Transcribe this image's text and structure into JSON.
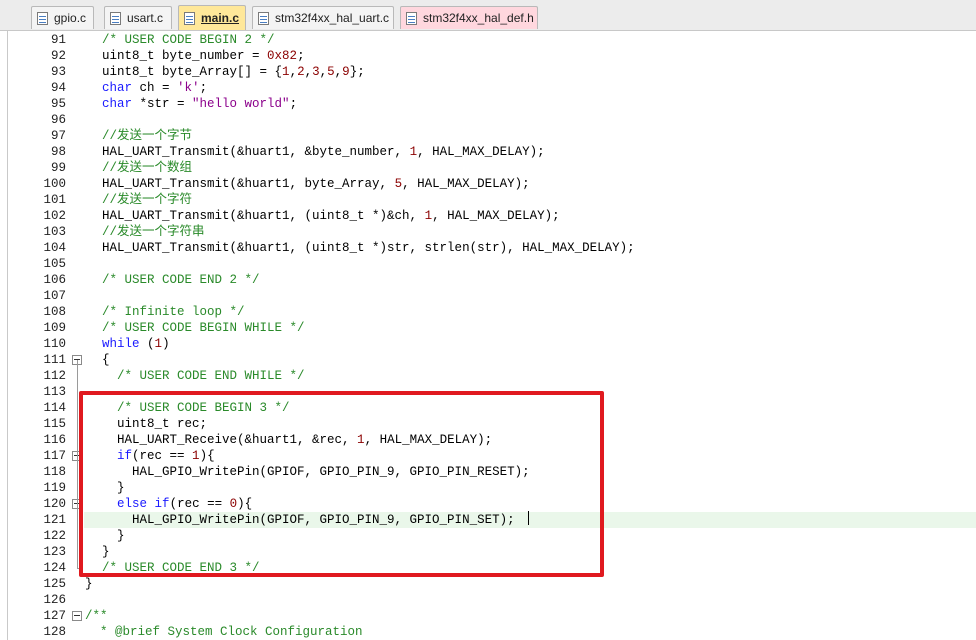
{
  "tabs": [
    {
      "label": "gpio.c",
      "active": false,
      "tint": "normal"
    },
    {
      "label": "usart.c",
      "active": false,
      "tint": "normal"
    },
    {
      "label": "main.c",
      "active": true,
      "tint": "active"
    },
    {
      "label": "stm32f4xx_hal_uart.c",
      "active": false,
      "tint": "normal"
    },
    {
      "label": "stm32f4xx_hal_def.h",
      "active": false,
      "tint": "pink"
    }
  ],
  "editor": {
    "current_line": 121,
    "highlight_color": "#e0191f",
    "lines": [
      {
        "n": "91",
        "text": "/* USER CODE BEGIN 2 */"
      },
      {
        "n": "92",
        "text": "uint8_t byte_number = 0x82;"
      },
      {
        "n": "93",
        "text": "uint8_t byte_Array[] = {1,2,3,5,9};"
      },
      {
        "n": "94",
        "text": "char ch = 'k';"
      },
      {
        "n": "95",
        "text": "char *str = \"hello world\";"
      },
      {
        "n": "96",
        "text": ""
      },
      {
        "n": "97",
        "text": "//发送一个字节"
      },
      {
        "n": "98",
        "text": "HAL_UART_Transmit(&huart1, &byte_number, 1, HAL_MAX_DELAY);"
      },
      {
        "n": "99",
        "text": "//发送一个数组"
      },
      {
        "n": "100",
        "text": "HAL_UART_Transmit(&huart1, byte_Array, 5, HAL_MAX_DELAY);"
      },
      {
        "n": "101",
        "text": "//发送一个字符"
      },
      {
        "n": "102",
        "text": "HAL_UART_Transmit(&huart1, (uint8_t *)&ch, 1, HAL_MAX_DELAY);"
      },
      {
        "n": "103",
        "text": "//发送一个字符串"
      },
      {
        "n": "104",
        "text": "HAL_UART_Transmit(&huart1, (uint8_t *)str, strlen(str), HAL_MAX_DELAY);"
      },
      {
        "n": "105",
        "text": ""
      },
      {
        "n": "106",
        "text": "/* USER CODE END 2 */"
      },
      {
        "n": "107",
        "text": ""
      },
      {
        "n": "108",
        "text": "/* Infinite loop */"
      },
      {
        "n": "109",
        "text": "/* USER CODE BEGIN WHILE */"
      },
      {
        "n": "110",
        "text": "while (1)"
      },
      {
        "n": "111",
        "text": "{"
      },
      {
        "n": "112",
        "text": "  /* USER CODE END WHILE */"
      },
      {
        "n": "113",
        "text": ""
      },
      {
        "n": "114",
        "text": "  /* USER CODE BEGIN 3 */"
      },
      {
        "n": "115",
        "text": "  uint8_t rec;"
      },
      {
        "n": "116",
        "text": "  HAL_UART_Receive(&huart1, &rec, 1, HAL_MAX_DELAY);"
      },
      {
        "n": "117",
        "text": "  if(rec == 1){"
      },
      {
        "n": "118",
        "text": "    HAL_GPIO_WritePin(GPIOF, GPIO_PIN_9, GPIO_PIN_RESET);"
      },
      {
        "n": "119",
        "text": "  }"
      },
      {
        "n": "120",
        "text": "  else if(rec == 0){"
      },
      {
        "n": "121",
        "text": "    HAL_GPIO_WritePin(GPIOF, GPIO_PIN_9, GPIO_PIN_SET);"
      },
      {
        "n": "122",
        "text": "  }"
      },
      {
        "n": "123",
        "text": "}"
      },
      {
        "n": "124",
        "text": "/* USER CODE END 3 */"
      },
      {
        "n": "125",
        "text": "}"
      },
      {
        "n": "126",
        "text": ""
      },
      {
        "n": "127",
        "text": "/**"
      },
      {
        "n": "128",
        "text": "  * @brief System Clock Configuration"
      }
    ]
  }
}
